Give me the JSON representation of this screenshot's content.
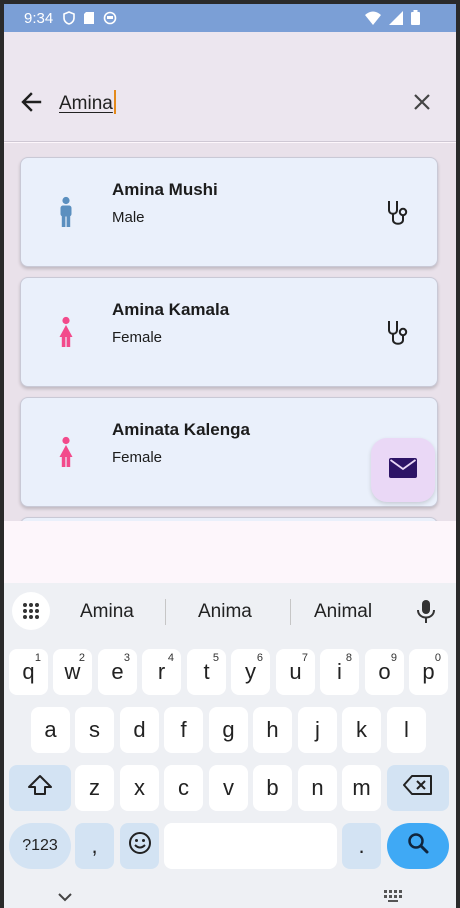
{
  "status_bar": {
    "time": "9:34"
  },
  "search": {
    "value": "Amina"
  },
  "results": [
    {
      "name": "Amina Mushi",
      "gender": "Male",
      "icon": "male-person-icon",
      "color": "#5b8fbf"
    },
    {
      "name": "Amina Kamala",
      "gender": "Female",
      "icon": "female-person-icon",
      "color": "#f24a8b"
    },
    {
      "name": "Aminata Kalenga",
      "gender": "Female",
      "icon": "female-person-icon",
      "color": "#f24a8b"
    }
  ],
  "keyboard": {
    "suggestions": [
      "Amina",
      "Anima",
      "Animal"
    ],
    "row1": [
      {
        "k": "q",
        "n": "1"
      },
      {
        "k": "w",
        "n": "2"
      },
      {
        "k": "e",
        "n": "3"
      },
      {
        "k": "r",
        "n": "4"
      },
      {
        "k": "t",
        "n": "5"
      },
      {
        "k": "y",
        "n": "6"
      },
      {
        "k": "u",
        "n": "7"
      },
      {
        "k": "i",
        "n": "8"
      },
      {
        "k": "o",
        "n": "9"
      },
      {
        "k": "p",
        "n": "0"
      }
    ],
    "row2": [
      "a",
      "s",
      "d",
      "f",
      "g",
      "h",
      "j",
      "k",
      "l"
    ],
    "row3": [
      "z",
      "x",
      "c",
      "v",
      "b",
      "n",
      "m"
    ],
    "symbols_label": "?123",
    "comma": ",",
    "period": "."
  },
  "colors": {
    "accent": "#3fa9f5",
    "fab_bg": "#ead8f6",
    "card_bg": "#eaf0fb"
  }
}
